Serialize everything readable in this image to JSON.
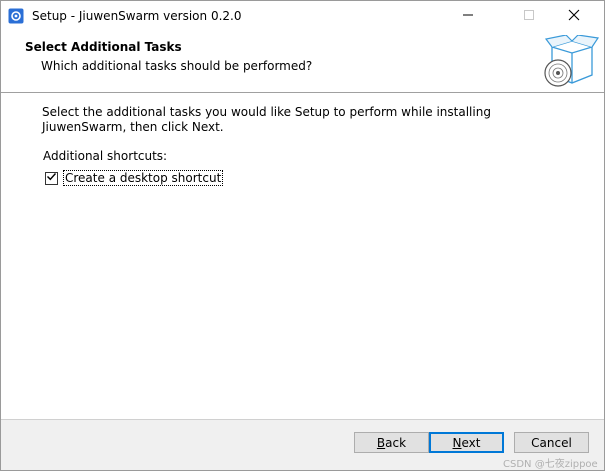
{
  "window": {
    "title": "Setup - JiuwenSwarm version 0.2.0",
    "app_icon": "setup-app-icon",
    "controls": [
      "minimize-icon",
      "maximize-icon",
      "close-icon"
    ]
  },
  "header": {
    "title": "Select Additional Tasks",
    "subtitle": "Which additional tasks should be performed?",
    "image": "setup-box-disc-icon"
  },
  "main": {
    "description": "Select the additional tasks you would like Setup to perform while installing JiuwenSwarm, then click Next.",
    "group_label": "Additional shortcuts:",
    "tasks": [
      {
        "label": "Create a desktop shortcut",
        "checked": true
      }
    ]
  },
  "footer": {
    "back_label": "Back",
    "back_accel": "B",
    "next_label": "Next",
    "next_accel": "N",
    "cancel_label": "Cancel"
  },
  "watermark": "CSDN @七夜zippoe",
  "colors": {
    "accent": "#0078d7",
    "footer_bg": "#f0f0f0",
    "button_bg": "#e1e1e1"
  }
}
